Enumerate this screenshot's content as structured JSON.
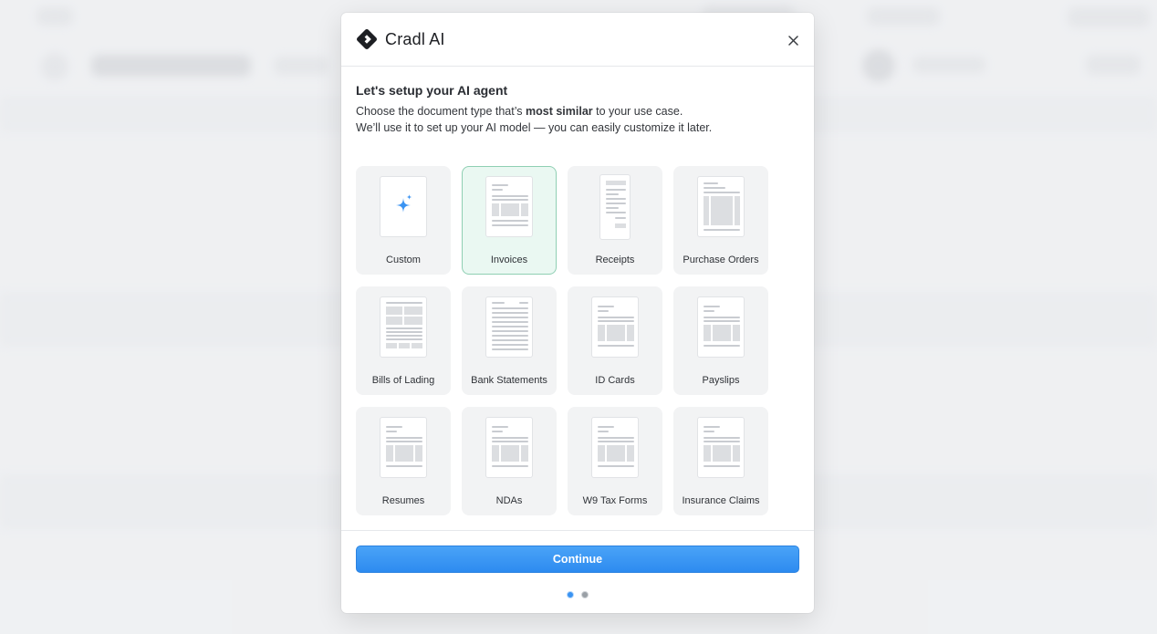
{
  "brand": {
    "name": "Cradl AI"
  },
  "modal": {
    "heading": "Let's setup your AI agent",
    "desc_prefix": "Choose the document type that’s ",
    "desc_bold": "most similar",
    "desc_suffix": " to your use case.",
    "desc_line2": "We’ll use it to set up your AI model — you can easily customize it later."
  },
  "doc_types": [
    {
      "label": "Custom",
      "icon": "sparkle-icon",
      "selected": false
    },
    {
      "label": "Invoices",
      "icon": "invoice-doc-icon",
      "selected": true
    },
    {
      "label": "Receipts",
      "icon": "receipt-doc-icon",
      "selected": false
    },
    {
      "label": "Purchase Orders",
      "icon": "purchase-order-doc-icon",
      "selected": false
    },
    {
      "label": "Bills of Lading",
      "icon": "bill-of-lading-doc-icon",
      "selected": false
    },
    {
      "label": "Bank Statements",
      "icon": "bank-statement-doc-icon",
      "selected": false
    },
    {
      "label": "ID Cards",
      "icon": "id-card-doc-icon",
      "selected": false
    },
    {
      "label": "Payslips",
      "icon": "payslip-doc-icon",
      "selected": false
    },
    {
      "label": "Resumes",
      "icon": "resume-doc-icon",
      "selected": false
    },
    {
      "label": "NDAs",
      "icon": "nda-doc-icon",
      "selected": false
    },
    {
      "label": "W9 Tax Forms",
      "icon": "w9-doc-icon",
      "selected": false
    },
    {
      "label": "Insurance Claims",
      "icon": "insurance-claim-doc-icon",
      "selected": false
    }
  ],
  "footer": {
    "continue_label": "Continue",
    "step_current": 1,
    "step_total": 2
  },
  "colors": {
    "accent": "#3a93f2",
    "selected_bg": "#eaf8f2",
    "selected_border": "#8fcfb3"
  }
}
